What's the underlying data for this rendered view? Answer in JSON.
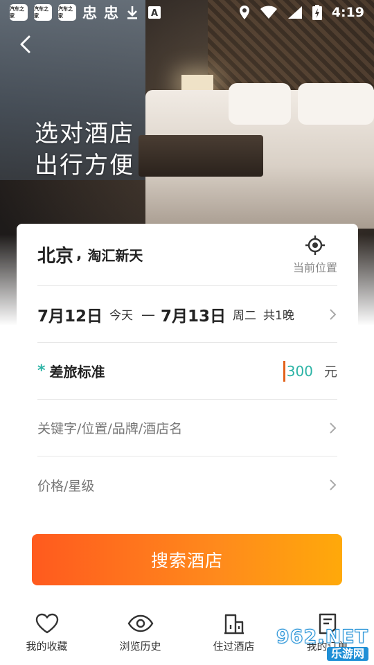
{
  "status_bar": {
    "time": "4:19",
    "app_icons": [
      "汽车之家",
      "汽车之家",
      "汽车之家"
    ],
    "glyphs": [
      "忠",
      "忠"
    ]
  },
  "hero": {
    "slogan_line1": "选对酒店",
    "slogan_line2": "出行方便"
  },
  "form": {
    "city": "北京",
    "city_separator": ",",
    "district": "淘汇新天",
    "locate_label": "当前位置",
    "checkin_date": "7月12日",
    "checkin_day": "今天",
    "date_dash": "—",
    "checkout_date": "7月13日",
    "checkout_day": "周二",
    "nights": "共1晚",
    "required_mark": "*",
    "budget_label": "差旅标准",
    "budget_value": "300",
    "budget_unit": "元",
    "keyword_placeholder": "关键字/位置/品牌/酒店名",
    "price_placeholder": "价格/星级",
    "search_button": "搜索酒店"
  },
  "tabbar": {
    "tabs": [
      {
        "label": "我的收藏",
        "icon": "heart-icon"
      },
      {
        "label": "浏览历史",
        "icon": "eye-icon"
      },
      {
        "label": "住过酒店",
        "icon": "building-icon"
      },
      {
        "label": "我的订单",
        "icon": "document-icon"
      }
    ]
  },
  "watermark": {
    "number": "962.NET",
    "site": "乐游网"
  },
  "colors": {
    "accent_teal": "#2bb3a5",
    "button_gradient_start": "#ff5a1e",
    "button_gradient_end": "#ffa90a",
    "caret": "#e2621b"
  }
}
